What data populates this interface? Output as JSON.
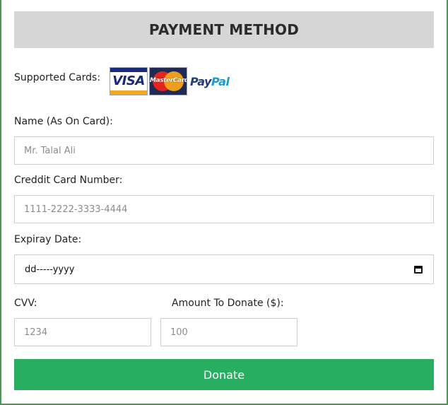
{
  "header": {
    "title": "PAYMENT METHOD"
  },
  "supported_cards": {
    "label": "Supported Cards:",
    "cards": [
      {
        "name": "VISA",
        "icon": "visa-card-icon"
      },
      {
        "name": "MasterCard",
        "icon": "mastercard-icon"
      },
      {
        "name": "PayPal",
        "icon": "paypal-icon"
      }
    ],
    "paypal_part1": "Pay",
    "paypal_part2": "Pal"
  },
  "form": {
    "name_label": "Name (As On Card):",
    "name_placeholder": "Mr. Talal Ali",
    "card_number_label": "Creddit Card Number:",
    "card_number_placeholder": "1111-2222-3333-4444",
    "expiry_label": "Expiray Date:",
    "expiry_value": "dd-----yyyy",
    "cvv_label": "CVV:",
    "cvv_placeholder": "1234",
    "amount_label": "Amount To Donate ($):",
    "amount_placeholder": "100"
  },
  "actions": {
    "donate_label": "Donate"
  },
  "colors": {
    "frame_border": "#4a9a56",
    "header_bg": "#d6d6d6",
    "donate_bg": "#27ae60",
    "visa_blue": "#1a2a7a",
    "visa_gold": "#f2a81d",
    "mastercard_red": "#e5231f",
    "mastercard_orange": "#f7a51b",
    "paypal_dark": "#253b80",
    "paypal_light": "#179bd7"
  }
}
